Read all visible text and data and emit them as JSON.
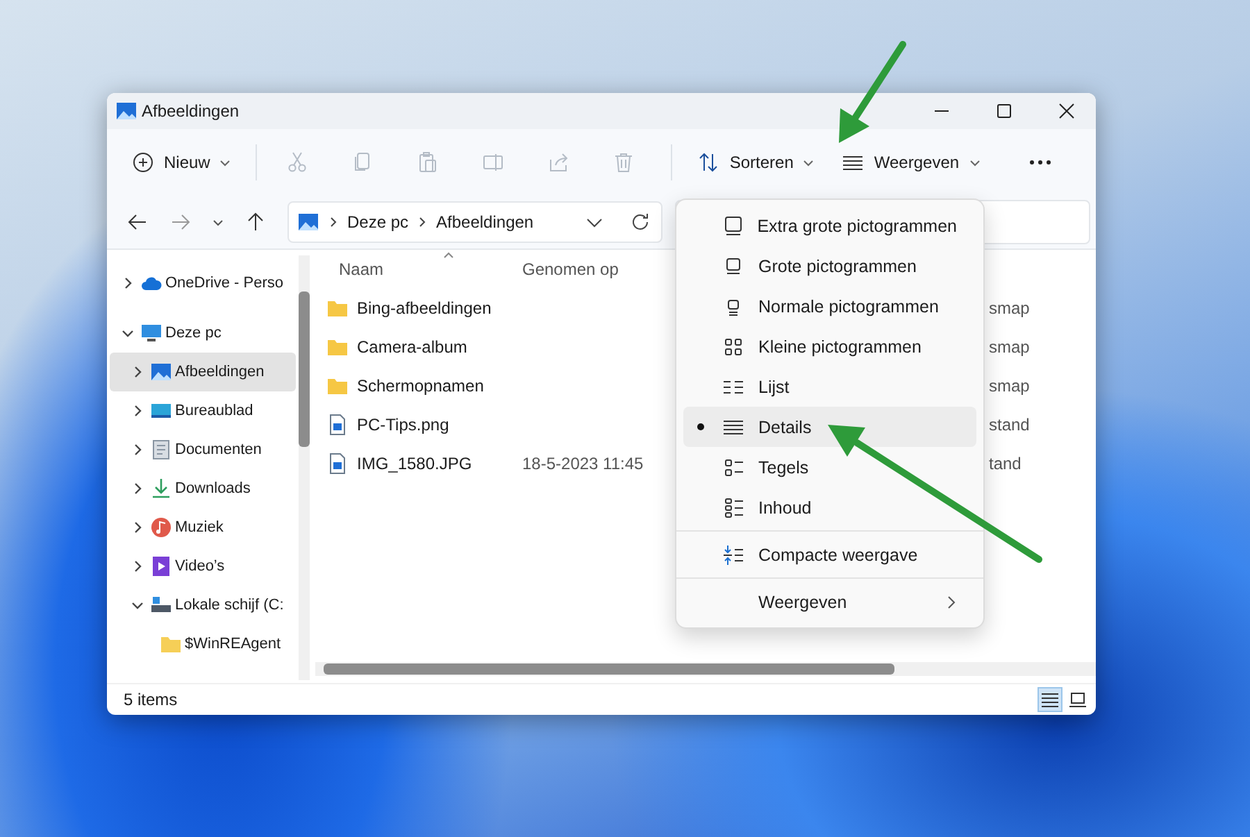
{
  "window": {
    "title": "Afbeeldingen"
  },
  "toolbar": {
    "new": "Nieuw",
    "actions": [
      {
        "kind": "cut",
        "disabled": true
      },
      {
        "kind": "copy",
        "disabled": true
      },
      {
        "kind": "paste",
        "disabled": true
      },
      {
        "kind": "rename",
        "disabled": true
      },
      {
        "kind": "share",
        "disabled": true
      },
      {
        "kind": "delete",
        "disabled": true
      }
    ],
    "sort": "Sorteren",
    "view": "Weergeven"
  },
  "address": {
    "path": [
      "Deze pc",
      "Afbeeldingen"
    ]
  },
  "sidebar": {
    "items": [
      {
        "label": "OneDrive - Perso",
        "kind": "cloud",
        "expanded": false,
        "selected": false
      },
      {
        "label": "Deze pc",
        "kind": "monitor",
        "expanded": true,
        "selected": false,
        "children": [
          {
            "label": "Afbeeldingen",
            "kind": "picture",
            "expanded": false,
            "selected": true
          },
          {
            "label": "Bureaublad",
            "kind": "desktop",
            "expanded": false,
            "selected": false
          },
          {
            "label": "Documenten",
            "kind": "document",
            "expanded": false,
            "selected": false
          },
          {
            "label": "Downloads",
            "kind": "download",
            "expanded": false,
            "selected": false
          },
          {
            "label": "Muziek",
            "kind": "music",
            "expanded": false,
            "selected": false
          },
          {
            "label": "Video’s",
            "kind": "video",
            "expanded": false,
            "selected": false
          },
          {
            "label": "Lokale schijf (C:",
            "kind": "drive",
            "expanded": true,
            "selected": false,
            "children": [
              {
                "label": "$WinREAgent",
                "kind": "folder",
                "selected": false
              }
            ]
          }
        ]
      }
    ]
  },
  "table": {
    "columns": [
      "Naam",
      "Genomen op"
    ],
    "rows": [
      {
        "kind": "folder",
        "name": "Bing-afbeeldingen",
        "type": "smap"
      },
      {
        "kind": "folder",
        "name": "Camera-album",
        "type": "smap"
      },
      {
        "kind": "folder",
        "name": "Schermopnamen",
        "type": "smap"
      },
      {
        "kind": "image",
        "name": "PC-Tips.png",
        "type": "stand"
      },
      {
        "kind": "image",
        "name": "IMG_1580.JPG",
        "date": "18-5-2023 11:45",
        "type": "tand"
      }
    ]
  },
  "status_bar": {
    "count": "5 items",
    "views": [
      {
        "kind": "details",
        "selected": true
      },
      {
        "kind": "tiles",
        "selected": false
      }
    ]
  },
  "view_menu": {
    "items": [
      {
        "kind": "extra-large",
        "label": "Extra grote pictogrammen",
        "selected": false
      },
      {
        "kind": "large",
        "label": "Grote pictogrammen",
        "selected": false
      },
      {
        "kind": "medium",
        "label": "Normale pictogrammen",
        "selected": false
      },
      {
        "kind": "small",
        "label": "Kleine pictogrammen",
        "selected": false
      },
      {
        "kind": "list",
        "label": "Lijst",
        "selected": false
      },
      {
        "kind": "details",
        "label": "Details",
        "selected": true
      },
      {
        "kind": "tiles",
        "label": "Tegels",
        "selected": false
      },
      {
        "kind": "content",
        "label": "Inhoud",
        "selected": false
      },
      {
        "kind": "compact",
        "label": "Compacte weergave",
        "checked": false
      },
      {
        "kind": "submenu",
        "label": "Weergeven"
      }
    ]
  }
}
